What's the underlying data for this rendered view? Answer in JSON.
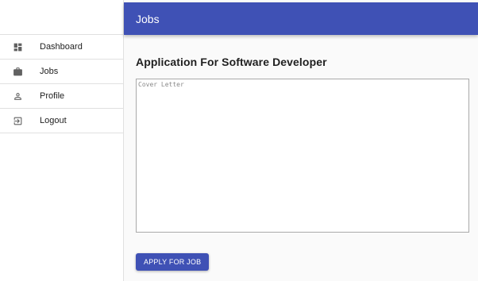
{
  "appbar": {
    "title": "Jobs"
  },
  "sidebar": {
    "items": [
      {
        "label": "Dashboard",
        "icon": "dashboard-icon"
      },
      {
        "label": "Jobs",
        "icon": "briefcase-icon"
      },
      {
        "label": "Profile",
        "icon": "person-icon"
      },
      {
        "label": "Logout",
        "icon": "logout-icon"
      }
    ]
  },
  "main": {
    "title": "Application For Software Developer",
    "cover_letter": {
      "placeholder": "Cover Letter",
      "value": ""
    },
    "apply_label": "APPLY FOR JOB"
  },
  "colors": {
    "primary": "#3f51b5",
    "background": "#fafafa"
  }
}
